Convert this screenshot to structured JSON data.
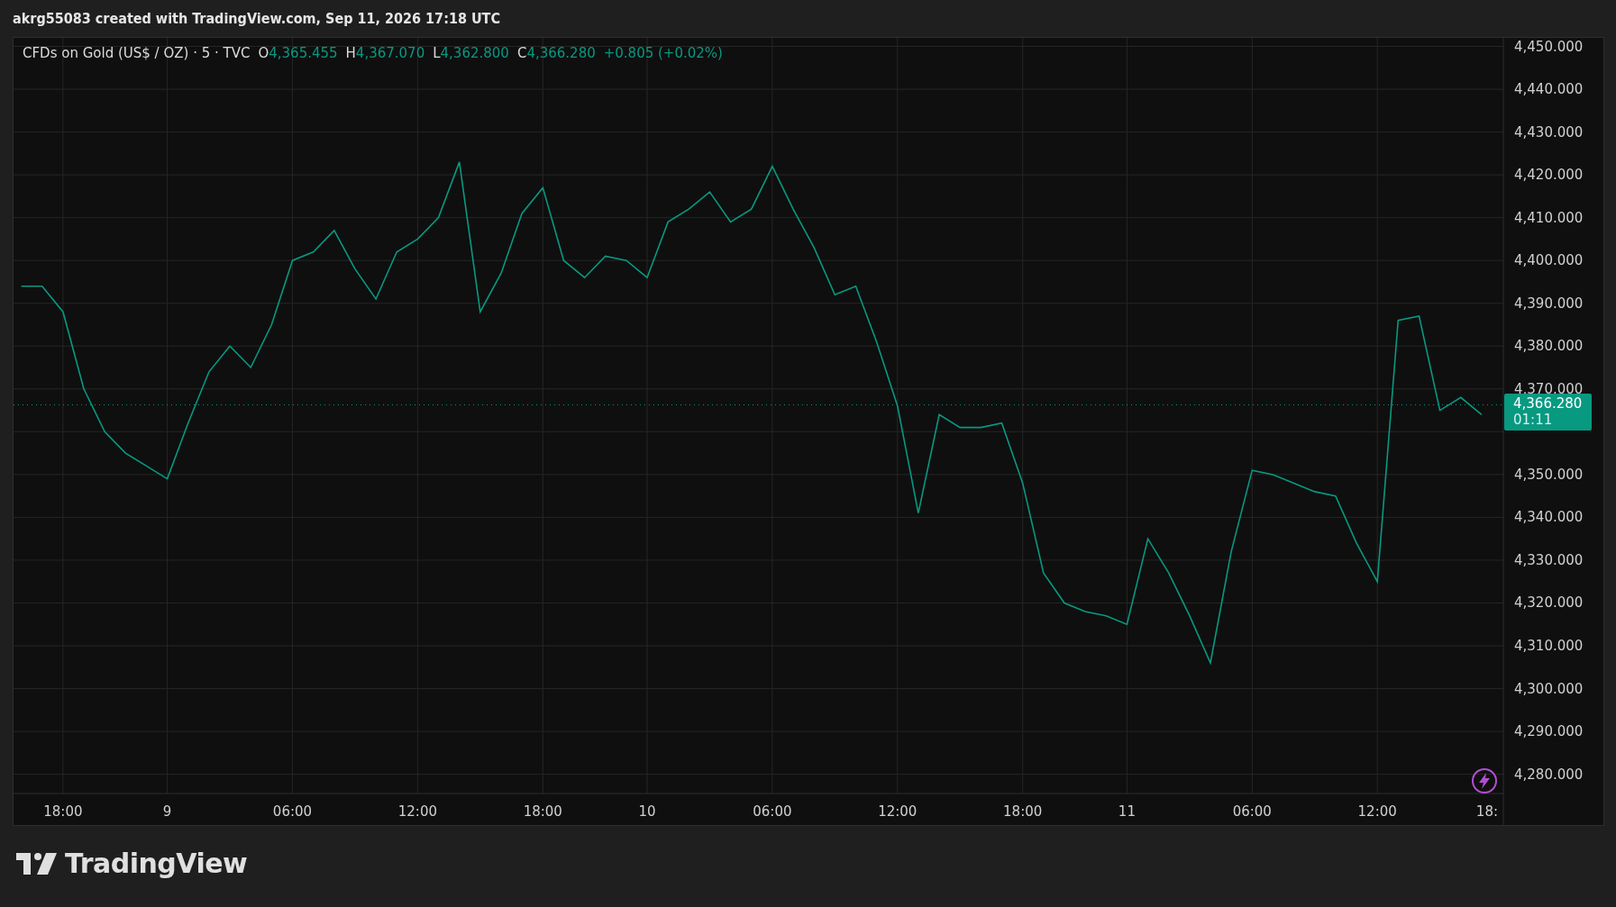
{
  "snapshot_caption": "akrg55083 created with TradingView.com, Sep 11, 2026 17:18 UTC",
  "legend": {
    "symbol": "CFDs on Gold (US$ / OZ) · 5 · TVC",
    "ohlc": [
      {
        "label": "O",
        "value": "4,365.455"
      },
      {
        "label": "H",
        "value": "4,367.070"
      },
      {
        "label": "L",
        "value": "4,362.800"
      },
      {
        "label": "C",
        "value": "4,366.280"
      }
    ],
    "change": "+0.805 (+0.02%)"
  },
  "time_axis_cut_label": "18:",
  "price_badge": {
    "price": "4,366.280",
    "countdown": "01:11"
  },
  "chart_data": {
    "type": "line",
    "grid": true,
    "ylim": [
      4275.5,
      4452
    ],
    "ref_lines": [
      {
        "axis": "y",
        "value": 4366.28,
        "color": "#089981"
      }
    ],
    "categories": [
      null,
      null,
      "18:00",
      null,
      null,
      null,
      null,
      "9",
      null,
      null,
      null,
      null,
      null,
      "06:00",
      null,
      null,
      null,
      null,
      null,
      "12:00",
      null,
      null,
      null,
      null,
      null,
      "18:00",
      null,
      null,
      null,
      null,
      "10",
      null,
      null,
      null,
      null,
      null,
      "06:00",
      null,
      null,
      null,
      null,
      null,
      "12:00",
      null,
      null,
      null,
      null,
      null,
      "18:00",
      null,
      null,
      null,
      null,
      "11",
      null,
      null,
      null,
      null,
      null,
      "06:00",
      null,
      null,
      null,
      null,
      null,
      "12:00",
      null,
      null,
      null,
      null,
      null
    ],
    "series": [
      {
        "color": "#089981",
        "values": [
          4394,
          4394,
          4388,
          4370,
          4360,
          4355,
          4352,
          4349,
          4362,
          4374,
          4380,
          4375,
          4385,
          4400,
          4402,
          4407,
          4398,
          4391,
          4402,
          4405,
          4410,
          4423,
          4388,
          4397,
          4411,
          4417,
          4400,
          4396,
          4401,
          4400,
          4396,
          4409,
          4412,
          4416,
          4409,
          4412,
          4422,
          4412,
          4403,
          4392,
          4394,
          4381,
          4366,
          4341,
          4364,
          4361,
          4361,
          4362,
          4348,
          4327,
          4320,
          4318,
          4317,
          4315,
          4335,
          4327,
          4317,
          4306,
          4332,
          4351,
          4350,
          4348,
          4346,
          4345,
          4334,
          4325,
          4386,
          4387,
          4365,
          4368,
          4364
        ]
      }
    ],
    "yticks": [
      {
        "value": 4450,
        "label": "4,450.000"
      },
      {
        "value": 4440,
        "label": "4,440.000"
      },
      {
        "value": 4430,
        "label": "4,430.000"
      },
      {
        "value": 4420,
        "label": "4,420.000"
      },
      {
        "value": 4410,
        "label": "4,410.000"
      },
      {
        "value": 4400,
        "label": "4,400.000"
      },
      {
        "value": 4390,
        "label": "4,390.000"
      },
      {
        "value": 4380,
        "label": "4,380.000"
      },
      {
        "value": 4370,
        "label": "4,370.000"
      },
      {
        "value": 4350,
        "label": "4,350.000"
      },
      {
        "value": 4340,
        "label": "4,340.000"
      },
      {
        "value": 4330,
        "label": "4,330.000"
      },
      {
        "value": 4320,
        "label": "4,320.000"
      },
      {
        "value": 4310,
        "label": "4,310.000"
      },
      {
        "value": 4300,
        "label": "4,300.000"
      },
      {
        "value": 4290,
        "label": "4,290.000"
      },
      {
        "value": 4280,
        "label": "4,280.000"
      }
    ]
  },
  "brand": {
    "name": "TradingView"
  }
}
